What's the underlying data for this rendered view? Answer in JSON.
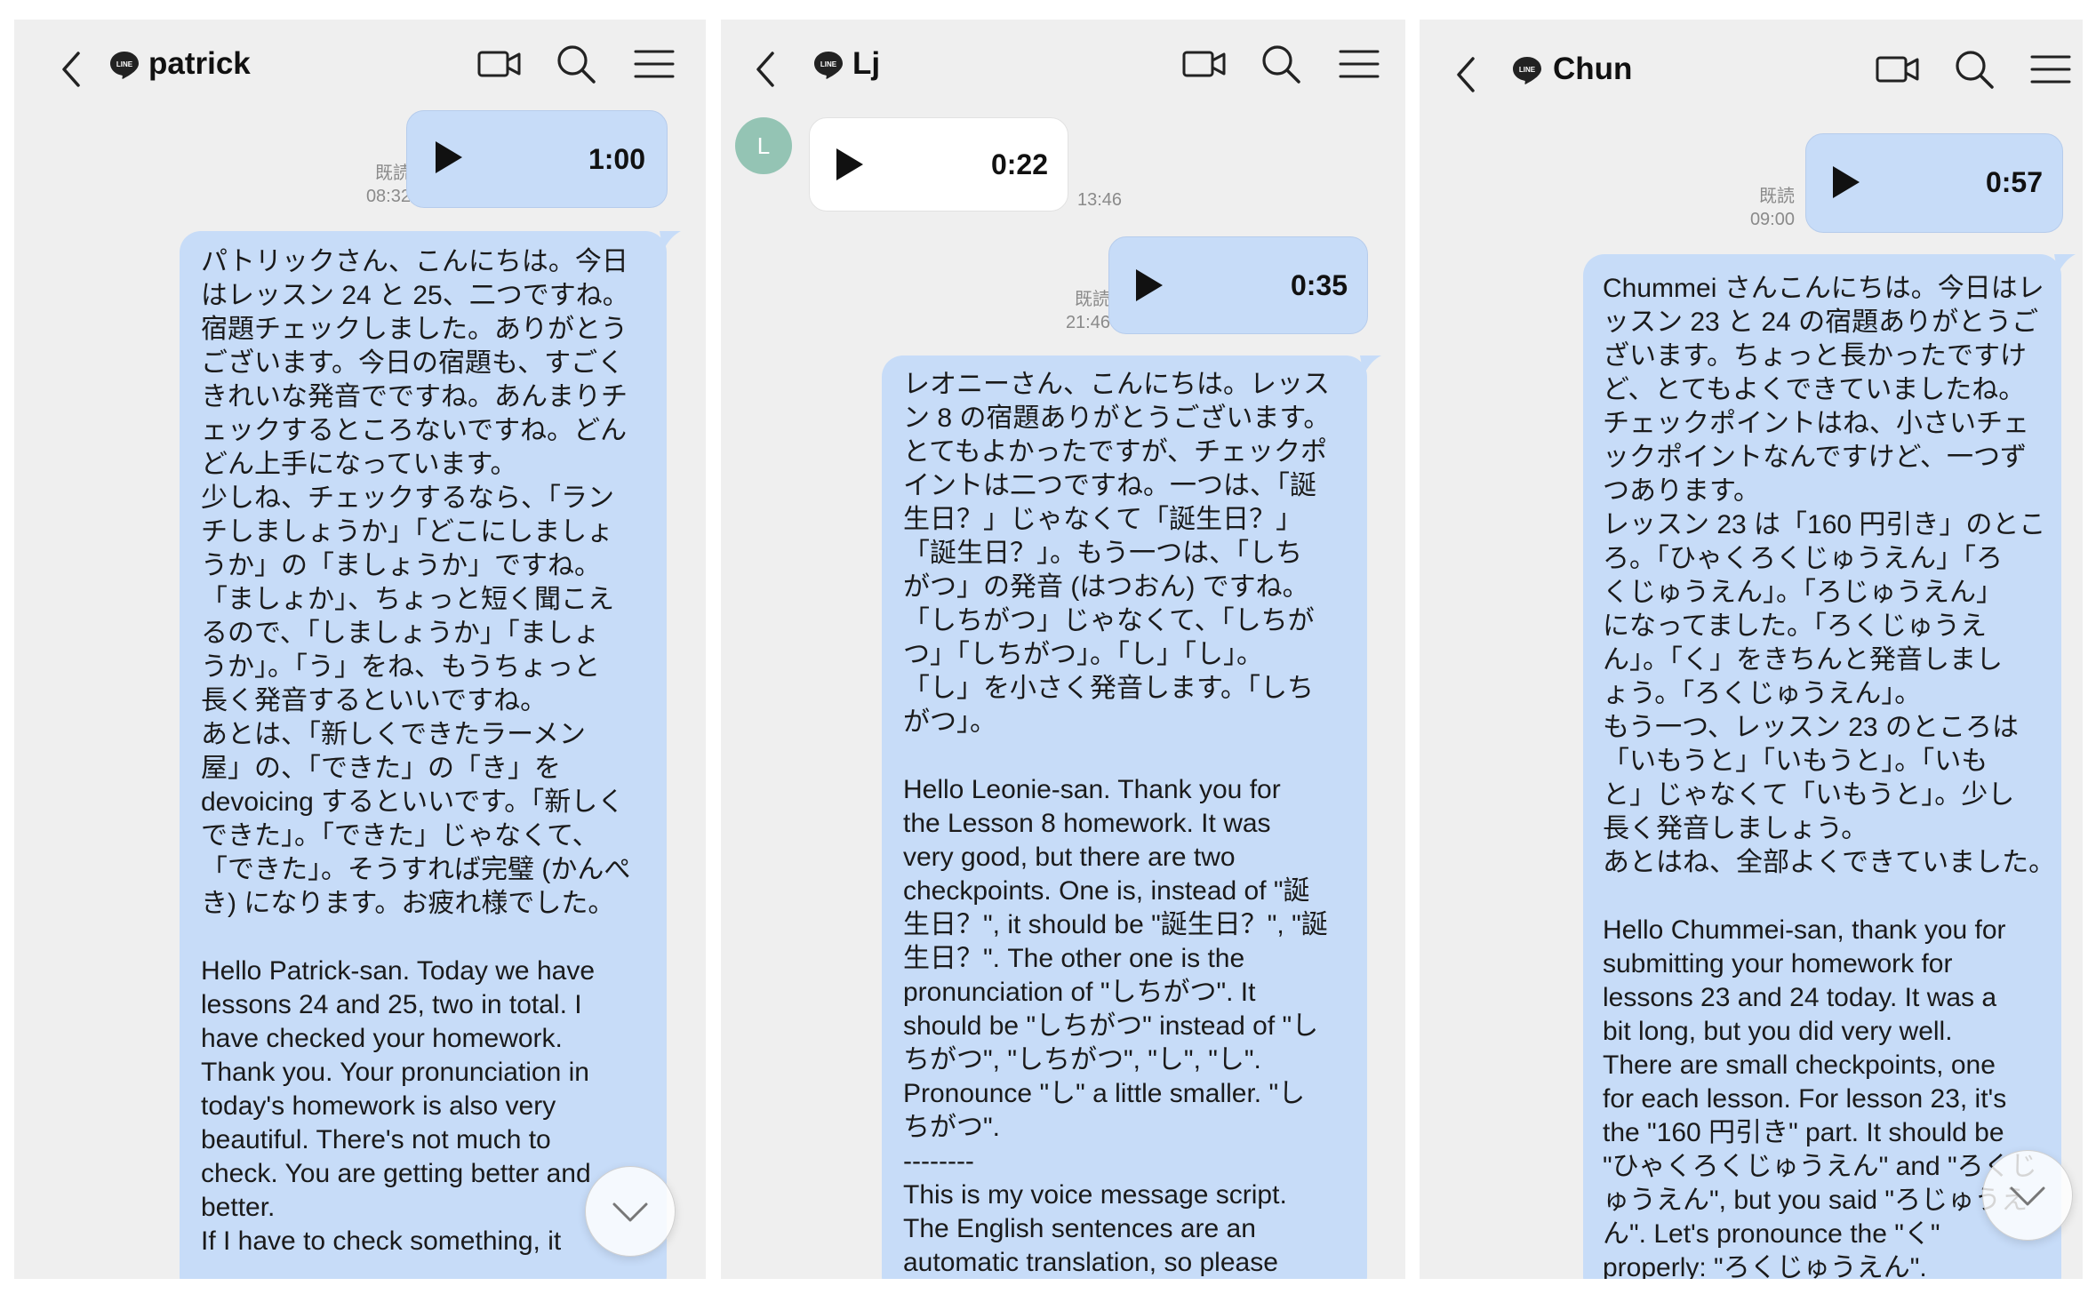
{
  "colors": {
    "panel_bg": "#efefef",
    "sent_bubble": "#c7dcf8",
    "received_bubble": "#ffffff",
    "avatar": "#94c4b4",
    "meta_text": "#8a8a8a"
  },
  "icons": {
    "back": "chevron-left-icon",
    "brand": "line-logo",
    "video_call": "video-camera-icon",
    "search": "search-icon",
    "menu": "hamburger-menu-icon",
    "play": "play-icon",
    "scroll_down": "chevron-down-icon"
  },
  "panels": [
    {
      "contact_name": "patrick",
      "voice_message": {
        "duration": "1:00",
        "read_label": "既読",
        "time": "08:32"
      },
      "text_message": "パトリックさん、こんにちは。今日\nはレッスン 24 と 25、二つですね。\n宿題チェックしました。ありがとう\nございます。今日の宿題も、すごく\nきれいな発音でですね。あんまりチ\nェックするところないですね。どん\nどん上手になっています。\n少しね、チェックするなら、「ラン\nチしましょうか」「どこにしましょ\nうか」の「ましょうか」ですね。\n「ましょか」、ちょっと短く聞こえ\nるので、「しましょうか」「ましょ\nうか」。「う」をね、もうちょっと\n長く発音するといいですね。\nあとは、「新しくできたラーメン\n屋」の、「できた」の「き」を\ndevoicing するといいです。「新しく\nできた」。「できた」じゃなくて、\n「できた」。そうすれば完璧 (かんぺ\nき) になります。お疲れ様でした。\n\nHello Patrick-san. Today we have\nlessons 24 and 25, two in total. I\nhave checked your homework.\nThank you. Your pronunciation in\ntoday's homework is also very\nbeautiful. There's not much to\ncheck. You are getting better and\nbetter.\nIf I have to check something, it"
    },
    {
      "contact_name": "Lj",
      "avatar_initial": "L",
      "received_voice": {
        "duration": "0:22",
        "time": "13:46"
      },
      "sent_voice": {
        "duration": "0:35",
        "read_label": "既読",
        "time": "21:46"
      },
      "text_message": "レオニーさん、こんにちは。レッス\nン 8 の宿題ありがとうございます。\nとてもよかったですが、チェックポ\nイントは二つですね。一つは、「誕\n生日？」じゃなくて「誕生日？」\n「誕生日？」。もう一つは、「しち\nがつ」の発音 (はつおん) ですね。\n「しちがつ」じゃなくて、「しちが\nつ」「しちがつ」。「し」「し」。\n「し」を小さく発音します。「しち\nがつ」。\n\nHello Leonie-san. Thank you for\nthe Lesson 8 homework. It was\nvery good, but there are two\ncheckpoints. One is, instead of \"誕\n生日？\", it should be \"誕生日？\", \"誕\n生日？\". The other one is the\npronunciation of \"しちがつ\". It\nshould be \"しちがつ\" instead of \"し\nちがつ\", \"しちがつ\", \"し\", \"し\".\nPronounce \"し\" a little smaller. \"し\nちがつ\".\n--------\nThis is my voice message script.\nThe English sentences are an\nautomatic translation, so please"
    },
    {
      "contact_name": "Chun",
      "voice_message": {
        "duration": "0:57",
        "read_label": "既読",
        "time": "09:00"
      },
      "text_message": "Chummei さんこんにちは。今日はレ\nッスン 23 と 24 の宿題ありがとうご\nざいます。ちょっと長かったですけ\nど、とてもよくできていましたね。\nチェックポイントはね、小さいチェ\nックポイントなんですけど、一つず\nつあります。\nレッスン 23 は「160 円引き」のとこ\nろ。「ひゃくろくじゅうえん」「ろ\nくじゅうえん」。「ろじゅうえん」\nになってました。「ろくじゅうえ\nん」。「く」をきちんと発音しまし\nょう。「ろくじゅうえん」。\nもう一つ、レッスン 23 のところは\n「いもうと」「いもうと」。「いも\nと」じゃなくて「いもうと」。少し\n長く発音しましょう。\nあとはね、全部よくできていました。\n\nHello Chummei-san, thank you for\nsubmitting your homework for\nlessons 23 and 24 today. It was a\nbit long, but you did very well.\nThere are small checkpoints, one\nfor each lesson. For lesson 23, it's\nthe \"160 円引き\" part. It should be\n\"ひゃくろくじゅうえん\" and \"ろくじ\nゅうえん\", but you said \"ろじゅうえ\nん\". Let's pronounce the \"く\"\nproperly: \"ろくじゅうえん\"."
    }
  ]
}
